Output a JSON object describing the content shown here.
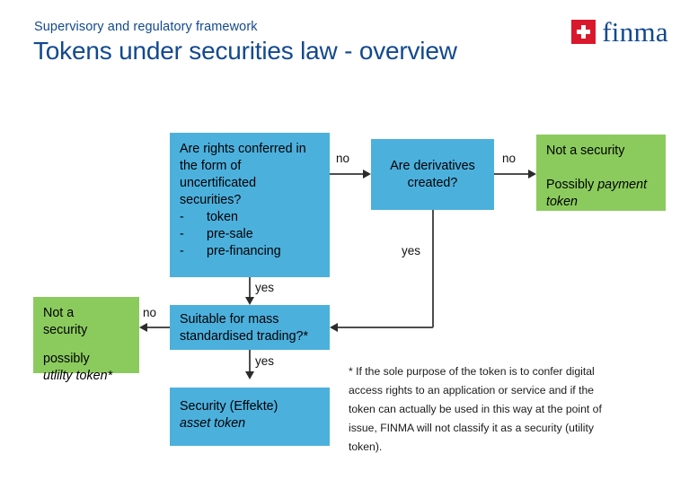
{
  "header": {
    "kicker": "Supervisory and regulatory framework",
    "title": "Tokens under securities law - overview",
    "logo_word": "finma",
    "logo_mark_name": "swiss-cross",
    "brand_blue": "#12498f",
    "brand_red": "#d9182c"
  },
  "palette": {
    "decision_blue": "#4cb0dd",
    "outcome_green": "#8bcb5e",
    "connector": "#4d4d4d"
  },
  "nodes": {
    "rights_question": {
      "line1": "Are rights conferred in",
      "line2": "the form of",
      "line3": "uncertificated",
      "line4": "securities?",
      "bullet_marker": "-",
      "bullets": [
        "token",
        "pre-sale",
        "pre-financing"
      ]
    },
    "derivatives_question": {
      "line1": "Are derivatives",
      "line2": "created?"
    },
    "payment_outcome": {
      "line1": "Not a security",
      "line2_prefix": "Possibly ",
      "line2_italic": "payment token"
    },
    "mass_trading_question": {
      "line1": "Suitable for mass",
      "line2": "standardised trading?*"
    },
    "utility_outcome": {
      "line1": "Not a",
      "line2": "security",
      "line3": "possibly",
      "line4_italic": "utlilty token*"
    },
    "security_outcome": {
      "line1": "Security (Effekte)",
      "line2_italic": "asset token"
    }
  },
  "edges": {
    "rights_to_derivatives": "no",
    "derivatives_to_payment": "no",
    "rights_to_mass_trading": "yes",
    "derivatives_to_mass_trading": "yes",
    "mass_trading_to_utility": "no",
    "mass_trading_to_security": "yes"
  },
  "footnote": {
    "text": "* If the sole purpose of the token is to confer digital access rights to an application or service and if the token can actually be used in this way at the point of issue, FINMA will not classify it as a security (utility token)."
  }
}
